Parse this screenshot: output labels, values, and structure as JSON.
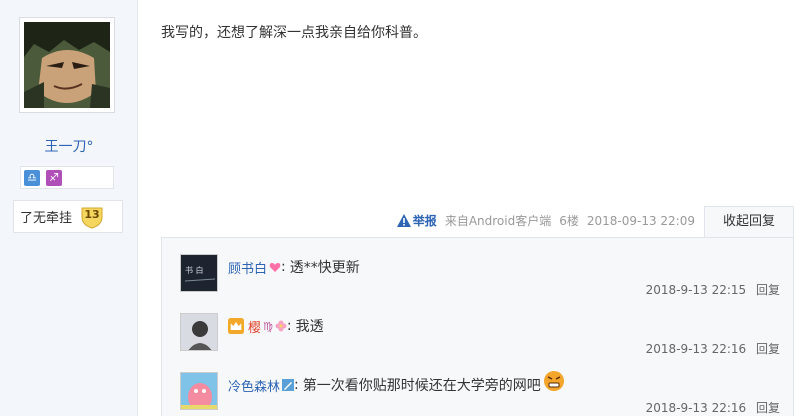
{
  "author": {
    "name": "王一刀°",
    "level_title": "了无牵挂",
    "level": "13",
    "signs": [
      "libra-sign-icon",
      "sagittarius-sign-icon"
    ]
  },
  "post": {
    "content": "我写的，还想了解深一点我亲自给你科普。",
    "report_label": "举报",
    "source": "来自Android客户端",
    "floor": "6楼",
    "time": "2018-09-13 22:09",
    "collapse_label": "收起回复"
  },
  "replies": [
    {
      "user": "顾书白",
      "separator": ":",
      "text": "透**快更新",
      "time": "2018-9-13 22:15",
      "reply_label": "回复",
      "icons": [
        "heart-icon"
      ]
    },
    {
      "user": "樱",
      "separator": ":",
      "text": "我透",
      "time": "2018-9-13 22:16",
      "reply_label": "回复",
      "icons": [
        "vip-crown-icon",
        "virgo-icon",
        "flower-icon"
      ]
    },
    {
      "user": "冷色森林",
      "separator": ":",
      "text": "第一次看你贴那时候还在大学旁的网吧",
      "time": "2018-9-13 22:16",
      "reply_label": "回复",
      "icons": [
        "pencil-icon",
        "angry-emoji-icon"
      ]
    }
  ],
  "colors": {
    "link": "#2d64b3",
    "sidebar_bg": "#f3f6fa",
    "panel_bg": "#f7f8fa"
  }
}
